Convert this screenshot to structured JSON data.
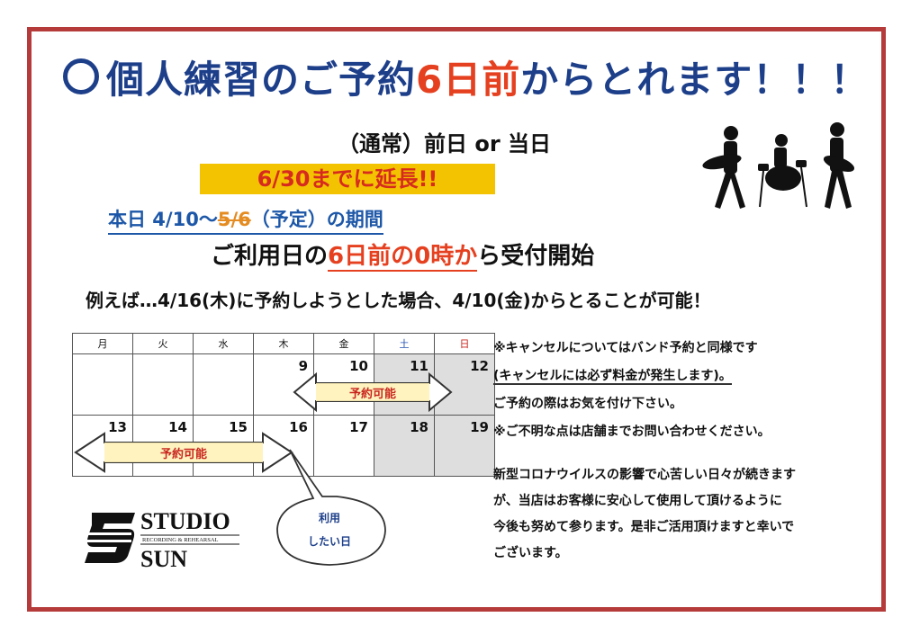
{
  "title": {
    "prefix": "個人練習のご予約",
    "highlight": "6日前",
    "suffix": "からとれます！！！"
  },
  "normal": "（通常）前日 or 当日",
  "extension": "6/30までに延長!!",
  "period": {
    "start": "本日 4/10～",
    "struck": "5/6",
    "end": "（予定）の期間"
  },
  "accept": {
    "prefix": "ご利用日の",
    "highlight": "6日前の0時か",
    "suffix": "ら受付開始"
  },
  "example": "例えば…4/16(木)に予約しようとした場合、4/10(金)からとることが可能！",
  "calendar": {
    "headers": [
      "月",
      "火",
      "水",
      "木",
      "金",
      "土",
      "日"
    ],
    "week1": [
      "",
      "",
      "",
      "9",
      "10",
      "11",
      "12"
    ],
    "week2": [
      "13",
      "14",
      "15",
      "16",
      "17",
      "18",
      "19"
    ],
    "arrow_label": "予約可能"
  },
  "bubble": {
    "line1": "利用",
    "line2": "したい日"
  },
  "notes": [
    "※キャンセルについてはバンド予約と同様です",
    "(キャンセルには必ず料金が発生します)。",
    "ご予約の際はお気を付け下さい。",
    "※ご不明な点は店舗までお問い合わせください。"
  ],
  "covid": [
    "新型コロナウイルスの影響で心苦しい日々が続きます",
    "が、当店はお客様に安心して使用して頂けるように",
    "今後も努めて参ります。是非ご活用頂けますと幸いで",
    "ございます。"
  ],
  "logo": {
    "line1": "STUDIO",
    "line2": "SUN",
    "tagline": "RECORDING & REHEARSAL"
  },
  "colors": {
    "frame": "#b53a3a",
    "blue": "#1d3f8a",
    "red": "#e5401f",
    "yellow": "#f3c200"
  }
}
